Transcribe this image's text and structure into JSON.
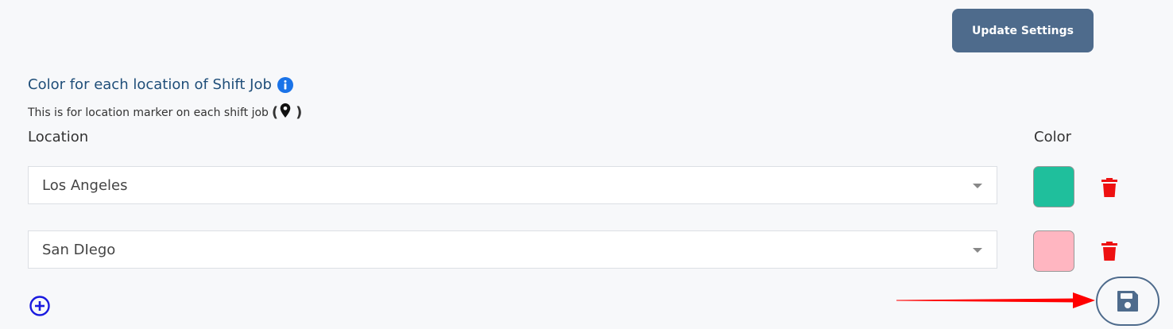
{
  "header": {
    "update_button_label": "Update Settings"
  },
  "section": {
    "title": "Color for each location of Shift Job",
    "subtitle": "This is for location marker on each shift job",
    "paren_open": "(",
    "paren_close": ")",
    "info_icon": "info-icon",
    "marker_icon": "map-marker-icon"
  },
  "columns": {
    "location": "Location",
    "color": "Color"
  },
  "rows": [
    {
      "location": "Los Angeles",
      "color": "#1fbf9c"
    },
    {
      "location": "San DIego",
      "color": "#ffb6c1"
    }
  ],
  "colors": {
    "accent": "#4e6b8c",
    "title": "#1f4e79",
    "delete": "#ee1111",
    "add": "#1a1adf",
    "arrow": "#ff0000"
  }
}
